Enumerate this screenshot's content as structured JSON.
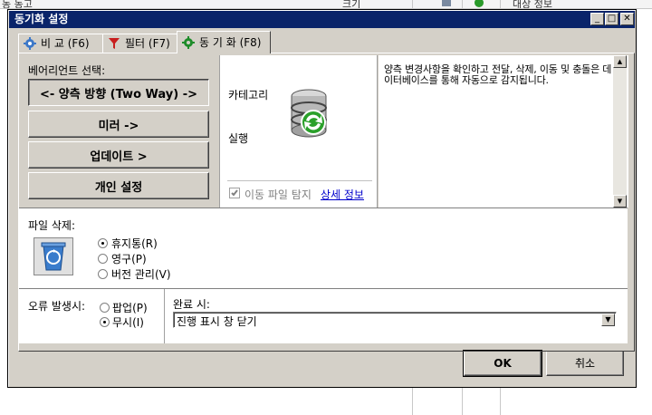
{
  "background": {
    "left_text": "동 동고",
    "mid_text": "크기",
    "right_text": "대상 정보"
  },
  "window": {
    "title": "동기화 설정",
    "minimize": "_",
    "maximize": "□",
    "close": "✕"
  },
  "tabs": [
    {
      "label": "비 교 (F6)",
      "icon": "gear-icon"
    },
    {
      "label": "필터 (F7)",
      "icon": "filter-funnel-icon"
    },
    {
      "label": "동 기 화 (F8)",
      "icon": "gear-green-icon",
      "active": true
    }
  ],
  "variant": {
    "heading": "베어리언트 선택:",
    "buttons": [
      {
        "label": "<- 양측 방향 (Two Way) ->",
        "pressed": true
      },
      {
        "label": "미러 ->"
      },
      {
        "label": "업데이트 >"
      },
      {
        "label": "개인 설정"
      }
    ]
  },
  "category": {
    "category_label": "카테고리",
    "run_label": "실행",
    "icon": "database-sync-icon",
    "detect_moved_label": "이동 파일 탐지",
    "detect_moved_checked": true,
    "details_link": "상세 정보"
  },
  "description": "양측 변경사항을 확인하고 전달, 삭제, 이동 및 충돌은 데이터베이스를 통해 자동으로 감지됩니다.",
  "file_delete": {
    "heading": "파일 삭제:",
    "icon": "recycle-bin-icon",
    "options": [
      {
        "label": "휴지통(R)",
        "selected": true
      },
      {
        "label": "영구(P)",
        "selected": false
      },
      {
        "label": "버전 관리(V)",
        "selected": false
      }
    ]
  },
  "on_error": {
    "heading": "오류 발생시:",
    "options": [
      {
        "label": "팝업(P)",
        "selected": false
      },
      {
        "label": "무시(I)",
        "selected": true
      }
    ]
  },
  "on_complete": {
    "heading": "완료 시:",
    "value": "진행 표시 창 닫기"
  },
  "footer": {
    "ok": "OK",
    "cancel": "취소"
  },
  "colors": {
    "titlebar": "#0a246a",
    "face": "#d4d0c8",
    "link": "#0000cc"
  }
}
